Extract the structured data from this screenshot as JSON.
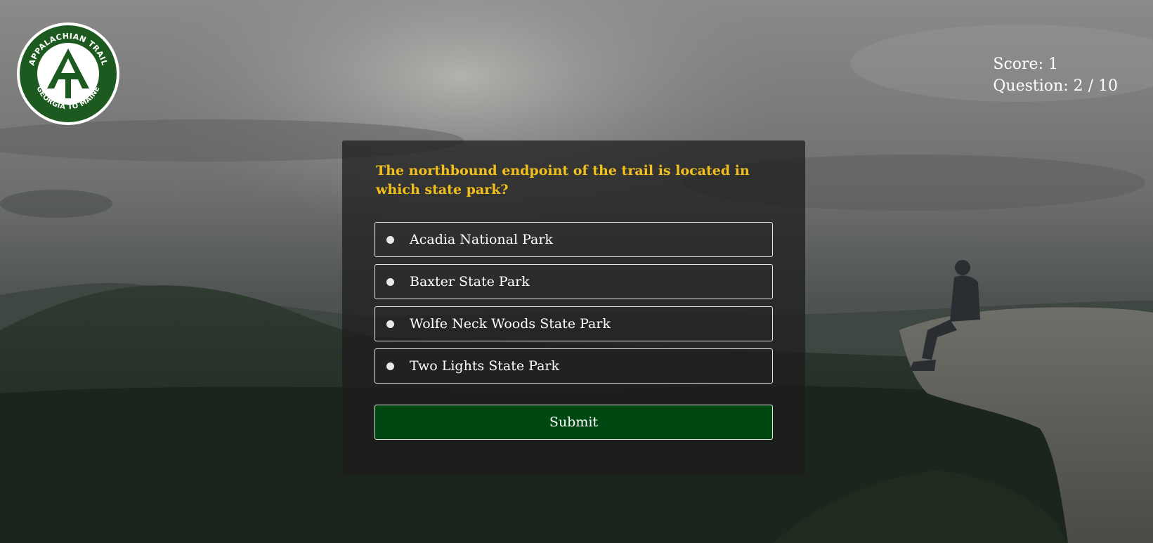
{
  "logo": {
    "top_text": "APPALACHIAN TRAIL",
    "bottom_text": "GEORGIA TO MAINE",
    "colors": {
      "green": "#1d5a1f",
      "white": "#ffffff"
    }
  },
  "stats": {
    "score": "Score: 1",
    "question": "Question: 2 / 10"
  },
  "quiz": {
    "question": "The northbound endpoint of the trail is located in which state park?",
    "options": [
      {
        "label": "Acadia National Park"
      },
      {
        "label": "Baxter State Park"
      },
      {
        "label": "Wolfe Neck Woods State Park"
      },
      {
        "label": "Two Lights State Park"
      }
    ],
    "submit_label": "Submit"
  },
  "colors": {
    "question_text": "#f2c01d",
    "submit_bg": "#004811",
    "card_bg": "rgba(28,28,28,0.74)"
  }
}
